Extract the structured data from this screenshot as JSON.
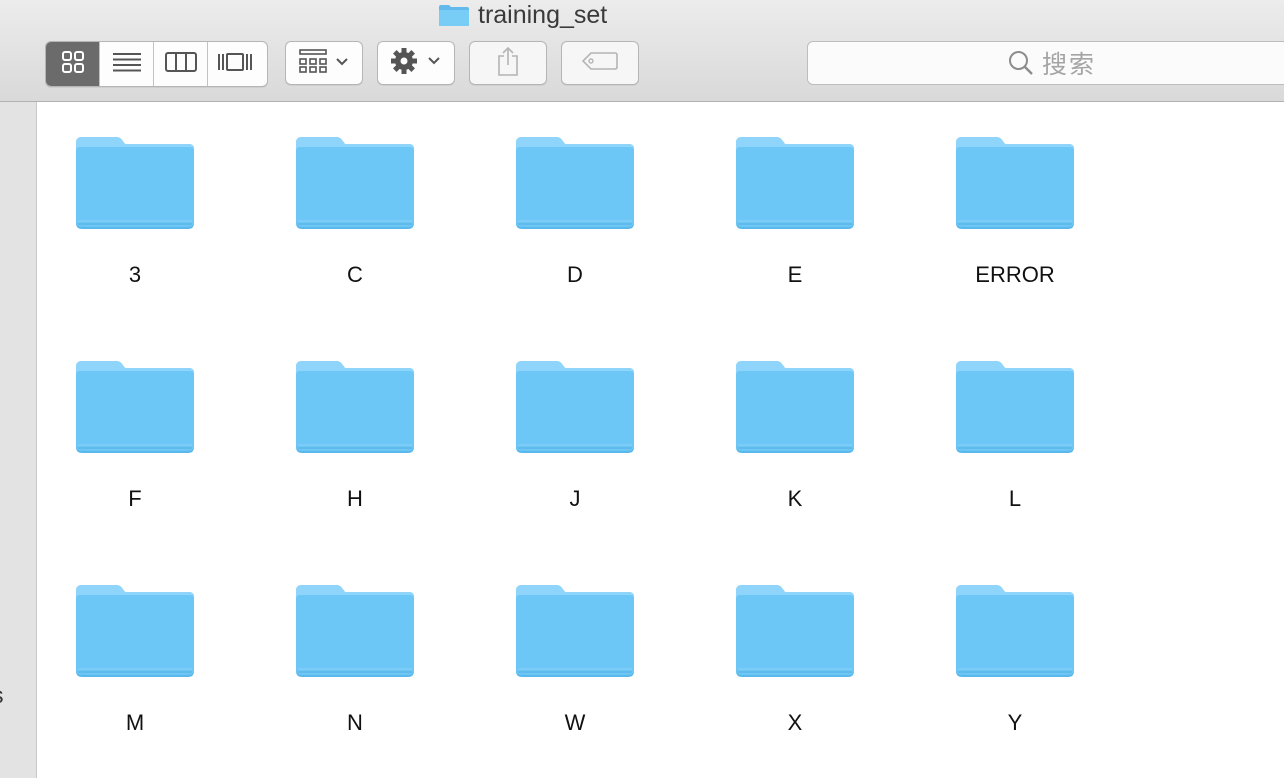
{
  "window": {
    "title": "training_set"
  },
  "toolbar": {
    "view_buttons": [
      {
        "icon": "icon-view-icon",
        "active": true
      },
      {
        "icon": "list-view-icon",
        "active": false
      },
      {
        "icon": "column-view-icon",
        "active": false
      },
      {
        "icon": "cover-flow-view-icon",
        "active": false
      }
    ],
    "arrange_icon": "arrange-grid-icon",
    "action_icon": "gear-icon",
    "share_icon": "share-icon",
    "tag_icon": "tag-icon",
    "search_placeholder": "搜索"
  },
  "sidebar": {
    "partial_text": "s"
  },
  "folders": [
    {
      "name": "3"
    },
    {
      "name": "C"
    },
    {
      "name": "D"
    },
    {
      "name": "E"
    },
    {
      "name": "ERROR"
    },
    {
      "name": "F"
    },
    {
      "name": "H"
    },
    {
      "name": "J"
    },
    {
      "name": "K"
    },
    {
      "name": "L"
    },
    {
      "name": "M"
    },
    {
      "name": "N"
    },
    {
      "name": "W"
    },
    {
      "name": "X"
    },
    {
      "name": "Y"
    }
  ],
  "colors": {
    "folder_blue": "#6cc6f6",
    "folder_tab": "#8fd4fa",
    "toolbar_bg": "#e4e4e4",
    "active_segment": "#6b6b6b"
  }
}
